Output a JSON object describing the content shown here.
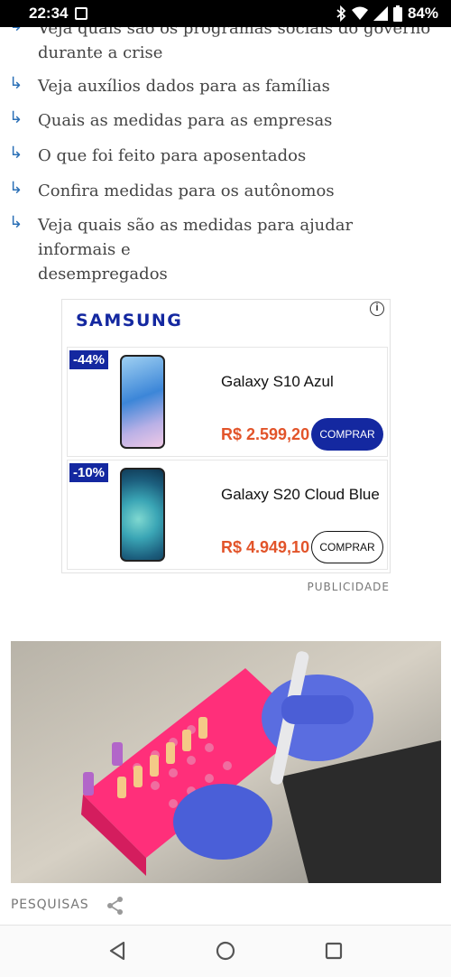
{
  "status_bar": {
    "time": "22:34",
    "battery": "84%"
  },
  "article_links": [
    {
      "line1": "Veja quais são os programas sociais do governo",
      "line2": "durante a crise"
    },
    {
      "line1": "Veja auxílios dados para as famílias",
      "line2": ""
    },
    {
      "line1": "Quais as medidas para as empresas",
      "line2": ""
    },
    {
      "line1": "O que foi feito para aposentados",
      "line2": ""
    },
    {
      "line1": "Confira medidas para os autônomos",
      "line2": ""
    },
    {
      "line1": "Veja quais são as medidas para ajudar informais e",
      "line2": "desempregados"
    }
  ],
  "arrow_glyph": "↳",
  "ad": {
    "brand": "SAMSUNG",
    "info": "i",
    "brand_color": "#1428a0",
    "price_color": "#e2542a",
    "products": [
      {
        "discount": "-44%",
        "name": "Galaxy S10 Azul",
        "price": "R$ 2.599,20",
        "button": "COMPRAR"
      },
      {
        "discount": "-10%",
        "name": "Galaxy S20 Cloud Blue",
        "price": "R$ 4.949,10",
        "button": "COMPRAR"
      }
    ],
    "label": "PUBLICIDADE"
  },
  "section": {
    "label": "PESQUISAS"
  },
  "icons": {
    "link_arrow": "link-arrow-icon",
    "share": "share-icon",
    "nav_back": "back-triangle-icon",
    "nav_home": "home-circle-icon",
    "nav_recents": "recents-square-icon"
  }
}
